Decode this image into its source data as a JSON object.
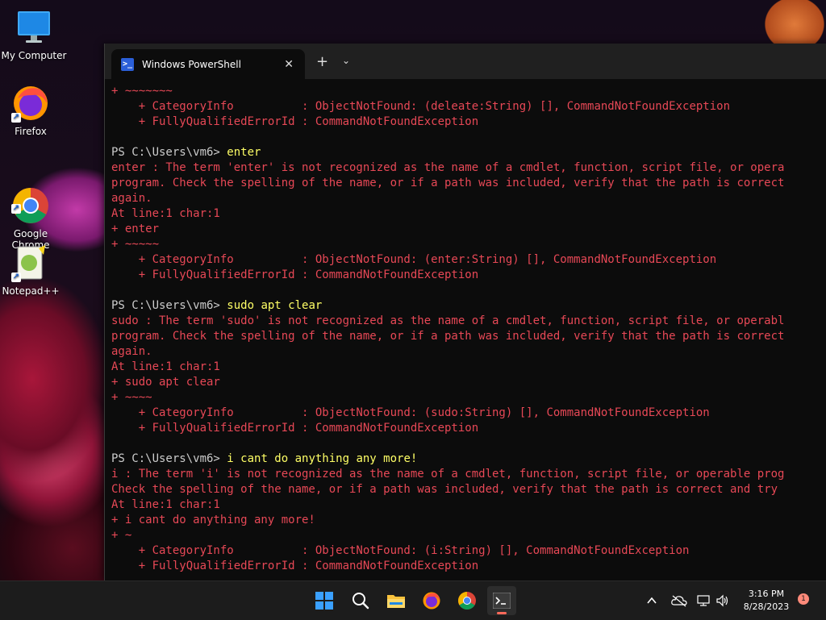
{
  "desktop": {
    "icons": [
      {
        "label": "My Computer",
        "icon": "monitor-icon"
      },
      {
        "label": "Firefox",
        "icon": "firefox-icon"
      },
      {
        "label": "Google\nChrome",
        "icon": "chrome-icon"
      },
      {
        "label": "Notepad++",
        "icon": "notepadpp-icon"
      }
    ]
  },
  "terminal": {
    "tab_title": "Windows PowerShell",
    "close_glyph": "✕",
    "new_tab_glyph": "+",
    "dropdown_glyph": "⌄",
    "lines": [
      {
        "t": "+ ~~~~~~~",
        "c": "err"
      },
      {
        "t": "    + CategoryInfo          : ObjectNotFound: (deleate:String) [], CommandNotFoundException",
        "c": "err"
      },
      {
        "t": "    + FullyQualifiedErrorId : CommandNotFoundException",
        "c": "err"
      },
      {
        "t": "",
        "c": ""
      },
      {
        "t": "PS C:\\Users\\vm6> ",
        "c": "prompt",
        "cmd": "enter"
      },
      {
        "t": "enter : The term 'enter' is not recognized as the name of a cmdlet, function, script file, or opera",
        "c": "err"
      },
      {
        "t": "program. Check the spelling of the name, or if a path was included, verify that the path is correct",
        "c": "err"
      },
      {
        "t": "again.",
        "c": "err"
      },
      {
        "t": "At line:1 char:1",
        "c": "err"
      },
      {
        "t": "+ enter",
        "c": "err"
      },
      {
        "t": "+ ~~~~~",
        "c": "err"
      },
      {
        "t": "    + CategoryInfo          : ObjectNotFound: (enter:String) [], CommandNotFoundException",
        "c": "err"
      },
      {
        "t": "    + FullyQualifiedErrorId : CommandNotFoundException",
        "c": "err"
      },
      {
        "t": "",
        "c": ""
      },
      {
        "t": "PS C:\\Users\\vm6> ",
        "c": "prompt",
        "cmd": "sudo apt clear"
      },
      {
        "t": "sudo : The term 'sudo' is not recognized as the name of a cmdlet, function, script file, or operabl",
        "c": "err"
      },
      {
        "t": "program. Check the spelling of the name, or if a path was included, verify that the path is correct",
        "c": "err"
      },
      {
        "t": "again.",
        "c": "err"
      },
      {
        "t": "At line:1 char:1",
        "c": "err"
      },
      {
        "t": "+ sudo apt clear",
        "c": "err"
      },
      {
        "t": "+ ~~~~",
        "c": "err"
      },
      {
        "t": "    + CategoryInfo          : ObjectNotFound: (sudo:String) [], CommandNotFoundException",
        "c": "err"
      },
      {
        "t": "    + FullyQualifiedErrorId : CommandNotFoundException",
        "c": "err"
      },
      {
        "t": "",
        "c": ""
      },
      {
        "t": "PS C:\\Users\\vm6> ",
        "c": "prompt",
        "cmd": "i cant do anything any more!"
      },
      {
        "t": "i : The term 'i' is not recognized as the name of a cmdlet, function, script file, or operable prog",
        "c": "err"
      },
      {
        "t": "Check the spelling of the name, or if a path was included, verify that the path is correct and try",
        "c": "err"
      },
      {
        "t": "At line:1 char:1",
        "c": "err"
      },
      {
        "t": "+ i cant do anything any more!",
        "c": "err"
      },
      {
        "t": "+ ~",
        "c": "err"
      },
      {
        "t": "    + CategoryInfo          : ObjectNotFound: (i:String) [], CommandNotFoundException",
        "c": "err"
      },
      {
        "t": "    + FullyQualifiedErrorId : CommandNotFoundException",
        "c": "err"
      }
    ]
  },
  "taskbar": {
    "apps": [
      {
        "name": "start-button",
        "icon": "windows-logo-icon"
      },
      {
        "name": "search-button",
        "icon": "search-icon"
      },
      {
        "name": "file-explorer-button",
        "icon": "folder-icon"
      },
      {
        "name": "firefox-taskbar-button",
        "icon": "firefox-icon"
      },
      {
        "name": "chrome-taskbar-button",
        "icon": "chrome-icon"
      },
      {
        "name": "terminal-taskbar-button",
        "icon": "terminal-icon"
      }
    ],
    "time": "3:16 PM",
    "date": "8/28/2023",
    "notification_count": "1",
    "colors": {
      "accent": "#ff6a5a",
      "error_text": "#e74856",
      "command_text": "#ffff66"
    }
  }
}
